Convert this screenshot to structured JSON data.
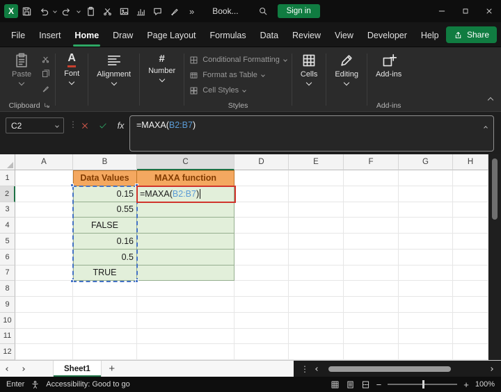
{
  "titlebar": {
    "title": "Book...",
    "sign_in_label": "Sign in",
    "overflow": "»"
  },
  "ribbon": {
    "tabs": [
      "File",
      "Insert",
      "Home",
      "Draw",
      "Page Layout",
      "Formulas",
      "Data",
      "Review",
      "View",
      "Developer",
      "Help"
    ],
    "active_tab": "Home",
    "share_label": "Share",
    "paste_label": "Paste",
    "clipboard_label": "Clipboard",
    "font_label": "Font",
    "alignment_label": "Alignment",
    "number_label": "Number",
    "styles_items": [
      "Conditional Formatting",
      "Format as Table",
      "Cell Styles"
    ],
    "styles_label": "Styles",
    "cells_label": "Cells",
    "editing_label": "Editing",
    "addins_label": "Add-ins",
    "addins_group_label": "Add-ins"
  },
  "formula_bar": {
    "name_box": "C2",
    "fx_label": "fx",
    "formula_prefix": "=MAXA(",
    "formula_ref": "B2:B7",
    "formula_suffix": ")"
  },
  "grid": {
    "columns": [
      "A",
      "B",
      "C",
      "D",
      "E",
      "F",
      "G",
      "H"
    ],
    "rows": [
      "1",
      "2",
      "3",
      "4",
      "5",
      "6",
      "7",
      "8",
      "9",
      "10",
      "11",
      "12"
    ],
    "cells": {
      "B1": "Data Values",
      "C1": "MAXA function",
      "B2": "0.15",
      "B3": "0.55",
      "B4": "FALSE",
      "B5": "0.16",
      "B6": "0.5",
      "B7": "TRUE"
    },
    "c2": {
      "prefix": "=MAXA(",
      "ref": "B2:B7",
      "suffix": ")"
    },
    "selected_cell": "C2"
  },
  "sheet_bar": {
    "tab": "Sheet1",
    "add_label": "+"
  },
  "status_bar": {
    "mode": "Enter",
    "accessibility": "Accessibility: Good to go",
    "zoom": "100%"
  },
  "colors": {
    "accent_green": "#107C41",
    "header_fill": "#F4A860",
    "header_text": "#833C00",
    "data_fill": "#E2EFDA",
    "reference_blue": "#4472C4",
    "editing_border_red": "#D0342C"
  }
}
